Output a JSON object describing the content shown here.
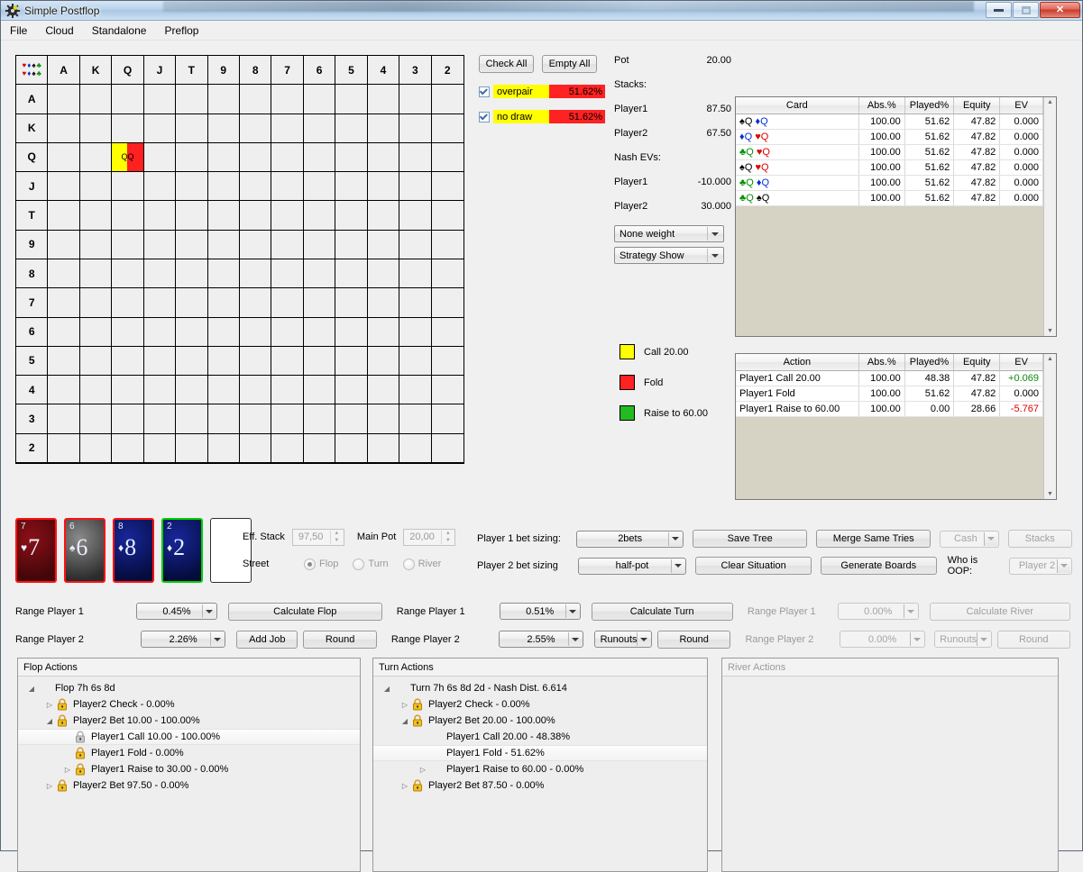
{
  "window": {
    "title": "Simple Postflop",
    "buttons": {
      "minimize": "—",
      "maximize": "❐",
      "close": "✕"
    }
  },
  "menu": {
    "items": [
      "File",
      "Cloud",
      "Standalone",
      "Preflop"
    ]
  },
  "matrix": {
    "suits": [
      "♥",
      "♦",
      "♠",
      "♣"
    ],
    "ranks": [
      "A",
      "K",
      "Q",
      "J",
      "T",
      "9",
      "8",
      "7",
      "6",
      "5",
      "4",
      "3",
      "2"
    ],
    "highlighted_cell": {
      "row": "Q",
      "col": "Q",
      "label": "QQ",
      "yellow_pct": 48.38,
      "red_pct": 51.62
    },
    "colors": {
      "yellow": "#ffff00",
      "red": "#ff2020",
      "green": "#22bb22"
    }
  },
  "filters": {
    "check_all_label": "Check All",
    "empty_all_label": "Empty All",
    "rows": [
      {
        "name": "overpair",
        "pct": "51.62%",
        "checked": true
      },
      {
        "name": "no draw",
        "pct": "51.62%",
        "checked": true
      }
    ]
  },
  "stats": {
    "pot_label": "Pot",
    "pot_value": "20.00",
    "stacks_label": "Stacks:",
    "stacks": [
      {
        "player": "Player1",
        "value": "87.50"
      },
      {
        "player": "Player2",
        "value": "67.50"
      }
    ],
    "nash_label": "Nash EVs:",
    "nash": [
      {
        "player": "Player1",
        "value": "-10.000"
      },
      {
        "player": "Player2",
        "value": "30.000"
      }
    ],
    "weight_select": "None weight",
    "strategy_select": "Strategy Show"
  },
  "legend": [
    {
      "color": "#ffff00",
      "label": "Call 20.00"
    },
    {
      "color": "#ff2222",
      "label": "Fold"
    },
    {
      "color": "#22bb22",
      "label": "Raise to 60.00"
    }
  ],
  "card_table": {
    "headers": [
      "Card",
      "Abs.%",
      "Played%",
      "Equity",
      "EV"
    ],
    "rows": [
      {
        "c1s": "♠",
        "c1sc": "sp",
        "c1r": "Q",
        "c2s": "♦",
        "c2sc": "di",
        "c2r": "Q",
        "abs": "100.00",
        "played": "51.62",
        "equity": "47.82",
        "ev": "0.000"
      },
      {
        "c1s": "♦",
        "c1sc": "di",
        "c1r": "Q",
        "c2s": "♥",
        "c2sc": "he",
        "c2r": "Q",
        "abs": "100.00",
        "played": "51.62",
        "equity": "47.82",
        "ev": "0.000"
      },
      {
        "c1s": "♣",
        "c1sc": "cl",
        "c1r": "Q",
        "c2s": "♥",
        "c2sc": "he",
        "c2r": "Q",
        "abs": "100.00",
        "played": "51.62",
        "equity": "47.82",
        "ev": "0.000"
      },
      {
        "c1s": "♠",
        "c1sc": "sp",
        "c1r": "Q",
        "c2s": "♥",
        "c2sc": "he",
        "c2r": "Q",
        "abs": "100.00",
        "played": "51.62",
        "equity": "47.82",
        "ev": "0.000"
      },
      {
        "c1s": "♣",
        "c1sc": "cl",
        "c1r": "Q",
        "c2s": "♦",
        "c2sc": "di",
        "c2r": "Q",
        "abs": "100.00",
        "played": "51.62",
        "equity": "47.82",
        "ev": "0.000"
      },
      {
        "c1s": "♣",
        "c1sc": "cl",
        "c1r": "Q",
        "c2s": "♠",
        "c2sc": "sp",
        "c2r": "Q",
        "abs": "100.00",
        "played": "51.62",
        "equity": "47.82",
        "ev": "0.000"
      }
    ]
  },
  "action_table": {
    "headers": [
      "Action",
      "Abs.%",
      "Played%",
      "Equity",
      "EV"
    ],
    "rows": [
      {
        "action": "Player1 Call 20.00",
        "abs": "100.00",
        "played": "48.38",
        "equity": "47.82",
        "ev": "+0.069",
        "ev_class": "ev-pos"
      },
      {
        "action": "Player1 Fold",
        "abs": "100.00",
        "played": "51.62",
        "equity": "47.82",
        "ev": "0.000",
        "ev_class": ""
      },
      {
        "action": "Player1 Raise to 60.00",
        "abs": "100.00",
        "played": "0.00",
        "equity": "28.66",
        "ev": "-5.767",
        "ev_class": "ev-neg"
      }
    ]
  },
  "board": {
    "cards": [
      {
        "rank": "7",
        "suit": "♥",
        "style": "red"
      },
      {
        "rank": "6",
        "suit": "♠",
        "style": "gray"
      },
      {
        "rank": "8",
        "suit": "♦",
        "style": "blue"
      },
      {
        "rank": "2",
        "suit": "♦",
        "style": "bluegreen"
      },
      {
        "rank": "",
        "suit": "",
        "style": "empty"
      }
    ]
  },
  "street_controls": {
    "eff_stack_label": "Eff. Stack",
    "eff_stack_value": "97,50",
    "main_pot_label": "Main Pot",
    "main_pot_value": "20,00",
    "street_label": "Street",
    "streets": [
      {
        "label": "Flop",
        "selected": true
      },
      {
        "label": "Turn",
        "selected": false
      },
      {
        "label": "River",
        "selected": false
      }
    ]
  },
  "bet_sizing": {
    "p1_label": "Player 1 bet sizing:",
    "p1_value": "2bets",
    "p2_label": "Player 2 bet sizing",
    "p2_value": "half-pot",
    "save_tree": "Save Tree",
    "clear_situation": "Clear Situation",
    "merge_same_tries": "Merge Same Tries",
    "generate_boards": "Generate Boards",
    "cash_value": "Cash",
    "stacks_button": "Stacks",
    "who_is_oop_label": "Who is OOP:",
    "who_is_oop_value": "Player 2"
  },
  "ranges": {
    "flop": {
      "p1_label": "Range Player 1",
      "p1_value": "0.45%",
      "p2_label": "Range Player 2",
      "p2_value": "2.26%",
      "calculate": "Calculate Flop",
      "add_job": "Add Job",
      "round": "Round"
    },
    "turn": {
      "p1_label": "Range Player 1",
      "p1_value": "0.51%",
      "p2_label": "Range Player 2",
      "p2_value": "2.55%",
      "calculate": "Calculate Turn",
      "runouts": "Runouts",
      "round": "Round"
    },
    "river": {
      "p1_label": "Range Player 1",
      "p1_value": "0.00%",
      "p2_label": "Range Player 2",
      "p2_value": "0.00%",
      "calculate": "Calculate River",
      "runouts": "Runouts",
      "round": "Round"
    }
  },
  "flop_actions": {
    "title": "Flop Actions",
    "nodes": [
      {
        "indent": 0,
        "exp": "open",
        "lock": false,
        "label": "Flop 7h 6s 8d",
        "sel": false
      },
      {
        "indent": 1,
        "exp": "closed",
        "lock": true,
        "label": "Player2 Check - 0.00%",
        "sel": false
      },
      {
        "indent": 1,
        "exp": "open",
        "lock": true,
        "label": "Player2 Bet 10.00 - 100.00%",
        "sel": false
      },
      {
        "indent": 2,
        "exp": "none",
        "lock": true,
        "lock_gray": true,
        "label": "Player1 Call 10.00 - 100.00%",
        "sel": true
      },
      {
        "indent": 2,
        "exp": "none",
        "lock": true,
        "label": "Player1 Fold - 0.00%",
        "sel": false
      },
      {
        "indent": 2,
        "exp": "closed",
        "lock": true,
        "label": "Player1 Raise to 30.00 - 0.00%",
        "sel": false
      },
      {
        "indent": 1,
        "exp": "closed",
        "lock": true,
        "label": "Player2 Bet 97.50 - 0.00%",
        "sel": false
      }
    ]
  },
  "turn_actions": {
    "title": "Turn Actions",
    "nodes": [
      {
        "indent": 0,
        "exp": "open",
        "lock": false,
        "label": "Turn 7h 6s 8d 2d - Nash Dist. 6.614",
        "sel": false
      },
      {
        "indent": 1,
        "exp": "closed",
        "lock": true,
        "label": "Player2 Check - 0.00%",
        "sel": false
      },
      {
        "indent": 1,
        "exp": "open",
        "lock": true,
        "label": "Player2 Bet 20.00 - 100.00%",
        "sel": false
      },
      {
        "indent": 2,
        "exp": "none",
        "lock": false,
        "label": "Player1 Call 20.00 - 48.38%",
        "sel": false
      },
      {
        "indent": 2,
        "exp": "none",
        "lock": false,
        "label": "Player1 Fold - 51.62%",
        "sel": true
      },
      {
        "indent": 2,
        "exp": "closed",
        "lock": false,
        "label": "Player1 Raise to 60.00 - 0.00%",
        "sel": false
      },
      {
        "indent": 1,
        "exp": "closed",
        "lock": true,
        "label": "Player2 Bet 87.50 - 0.00%",
        "sel": false
      }
    ]
  },
  "river_actions": {
    "title": "River Actions",
    "nodes": []
  }
}
